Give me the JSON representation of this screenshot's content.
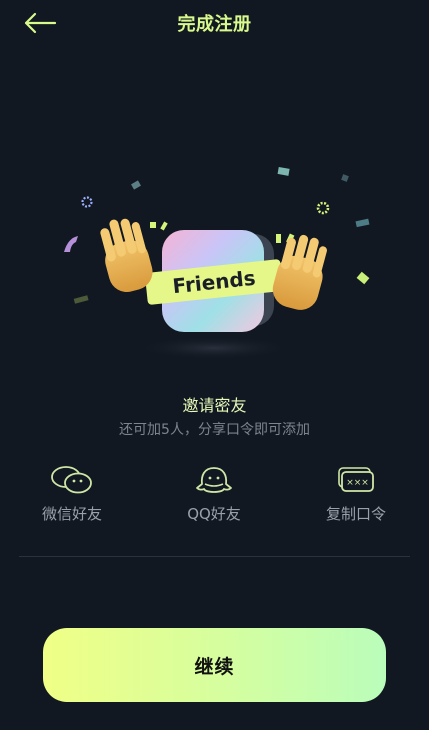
{
  "header": {
    "title": "完成注册",
    "back_icon": "arrow-left-icon"
  },
  "illustration": {
    "card_label": "Friends",
    "description_icons": [
      "clapping-hand-left-icon",
      "clapping-hand-right-icon",
      "confetti-icon"
    ]
  },
  "invite": {
    "title": "邀请密友",
    "subtitle": "还可加5人，分享口令即可添加"
  },
  "share_options": [
    {
      "label": "微信好友",
      "icon": "wechat-icon"
    },
    {
      "label": "QQ好友",
      "icon": "qq-icon"
    },
    {
      "label": "复制口令",
      "icon": "copy-code-icon"
    }
  ],
  "continue_button": {
    "label": "继续"
  },
  "colors": {
    "background": "#111822",
    "accent": "#d8f98c",
    "subtitle": "#7d848e",
    "icon_stroke": "#cfe7a6"
  }
}
